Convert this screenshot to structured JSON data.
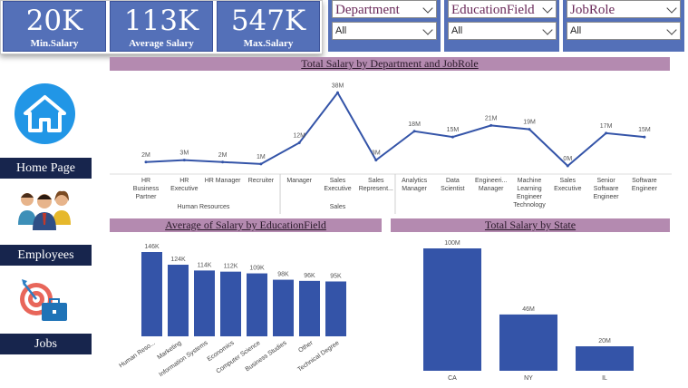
{
  "kpis": {
    "min": {
      "value": "20K",
      "label": "Min.Salary"
    },
    "avg": {
      "value": "113K",
      "label": "Average Salary"
    },
    "max": {
      "value": "547K",
      "label": "Max.Salary"
    }
  },
  "filters": [
    {
      "title": "Department",
      "selected": "All"
    },
    {
      "title": "EducationField",
      "selected": "All"
    },
    {
      "title": "JobRole",
      "selected": "All"
    }
  ],
  "nav": {
    "home": "Home Page",
    "employees": "Employees",
    "jobs": "Jobs",
    "icons": [
      "home-icon",
      "employees-group-icon",
      "jobs-target-icon"
    ]
  },
  "colors": {
    "bar": "#3454a8",
    "kpi": "#5470b8",
    "title_band": "#b48ab0",
    "nav": "#17254d",
    "home": "#2196e6"
  },
  "chart_data": [
    {
      "type": "line",
      "title": "Total Salary by Department and JobRole",
      "categories": [
        "HR Business Partner",
        "HR Executive",
        "HR Manager",
        "Recruiter",
        "Manager",
        "Sales Executive",
        "Sales Represent...",
        "Analytics Manager",
        "Data Scientist",
        "Engineeri... Manager",
        "Machine Learning Engineer Technology",
        "Sales Executive",
        "Senior Software Engineer",
        "Software Engineer"
      ],
      "values": [
        2,
        3,
        2,
        1,
        12,
        38,
        3,
        18,
        15,
        21,
        19,
        0,
        17,
        15
      ],
      "data_labels": [
        "2M",
        "3M",
        "2M",
        "1M",
        "12M",
        "38M",
        "3M",
        "18M",
        "15M",
        "21M",
        "19M",
        "0M",
        "17M",
        "15M"
      ],
      "groups": [
        {
          "name": "Human Resources",
          "start": 0,
          "end": 3
        },
        {
          "name": "Sales",
          "start": 4,
          "end": 6
        }
      ],
      "ylim": [
        0,
        40
      ]
    },
    {
      "type": "bar",
      "title": "Average of Salary by EducationField",
      "categories": [
        "Human Reso...",
        "Marketing",
        "Information Systems",
        "Economics",
        "Computer Science",
        "Business Studies",
        "Other",
        "Technical Degree"
      ],
      "values": [
        146,
        124,
        114,
        112,
        109,
        98,
        96,
        95
      ],
      "data_labels": [
        "146K",
        "124K",
        "114K",
        "112K",
        "109K",
        "98K",
        "96K",
        "95K"
      ],
      "ylim": [
        0,
        146
      ]
    },
    {
      "type": "bar",
      "title": "Total Salary by State",
      "categories": [
        "CA",
        "NY",
        "IL"
      ],
      "values": [
        100,
        46,
        20
      ],
      "data_labels": [
        "100M",
        "46M",
        "20M"
      ],
      "ylim": [
        0,
        100
      ]
    }
  ]
}
